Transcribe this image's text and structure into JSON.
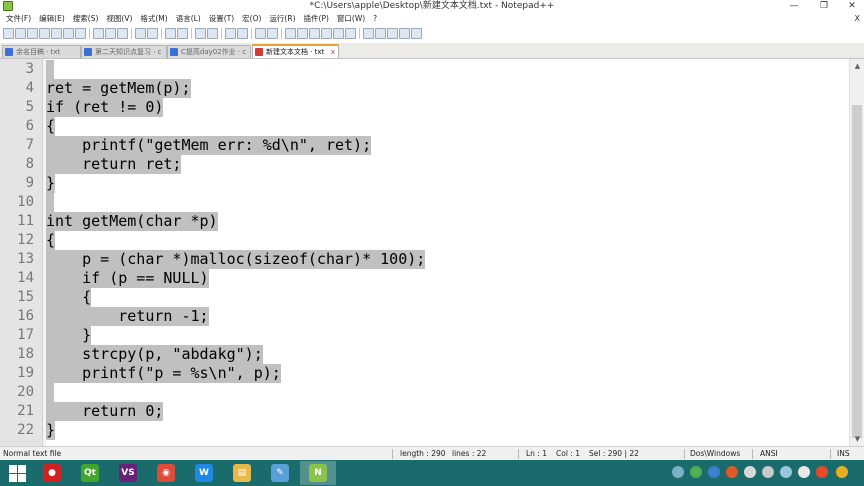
{
  "window": {
    "title": "*C:\\Users\\apple\\Desktop\\新建文本文档.txt - Notepad++",
    "minimize": "—",
    "maximize": "❐",
    "close": "✕"
  },
  "menu": [
    "文件(F)",
    "编辑(E)",
    "搜索(S)",
    "视图(V)",
    "格式(M)",
    "语言(L)",
    "设置(T)",
    "宏(O)",
    "运行(R)",
    "插件(P)",
    "窗口(W)",
    "?"
  ],
  "menu_close": "X",
  "tabs": [
    {
      "label": "余名目稿 · txt",
      "active": false
    },
    {
      "label": "第二天知识点复习 · c",
      "active": false
    },
    {
      "label": "C提高day02作业 · c",
      "active": false
    },
    {
      "label": "新建文本文档 · txt",
      "active": true
    }
  ],
  "tab_close": "x",
  "code_lines": [
    {
      "n": "3",
      "text": ""
    },
    {
      "n": "4",
      "text": "ret = getMem(p);"
    },
    {
      "n": "5",
      "text": "if (ret != 0)"
    },
    {
      "n": "6",
      "text": "{"
    },
    {
      "n": "7",
      "text": "    printf(\"getMem err: %d\\n\", ret);"
    },
    {
      "n": "8",
      "text": "    return ret;"
    },
    {
      "n": "9",
      "text": "}"
    },
    {
      "n": "10",
      "text": ""
    },
    {
      "n": "11",
      "text": "int getMem(char *p)"
    },
    {
      "n": "12",
      "text": "{"
    },
    {
      "n": "13",
      "text": "    p = (char *)malloc(sizeof(char)* 100);"
    },
    {
      "n": "14",
      "text": "    if (p == NULL)"
    },
    {
      "n": "15",
      "text": "    {"
    },
    {
      "n": "16",
      "text": "        return -1;"
    },
    {
      "n": "17",
      "text": "    }"
    },
    {
      "n": "18",
      "text": "    strcpy(p, \"abdakg\");"
    },
    {
      "n": "19",
      "text": "    printf(\"p = %s\\n\", p);"
    },
    {
      "n": "20",
      "text": ""
    },
    {
      "n": "21",
      "text": "    return 0;"
    },
    {
      "n": "22",
      "text": "}"
    }
  ],
  "scroll": {
    "up": "▲",
    "down": "▼"
  },
  "status": {
    "file_type": "Normal text file",
    "length": "length : 290",
    "lines": "lines : 22",
    "ln": "Ln : 1",
    "col": "Col : 1",
    "sel": "Sel : 290 | 22",
    "eol": "Dos\\Windows",
    "encoding": "ANSI",
    "mode": "INS"
  },
  "taskbar": {
    "apps": [
      {
        "icon": "red-record-icon",
        "color": "#d32020",
        "glyph": "●"
      },
      {
        "icon": "qt-creator-icon",
        "color": "#41a62a",
        "glyph": "Qt"
      },
      {
        "icon": "visual-studio-icon",
        "color": "#68217a",
        "glyph": "VS"
      },
      {
        "icon": "chrome-icon",
        "color": "#dd4b39",
        "glyph": "◉"
      },
      {
        "icon": "wps-writer-icon",
        "color": "#1e88e5",
        "glyph": "W"
      },
      {
        "icon": "file-explorer-icon",
        "color": "#e8b84a",
        "glyph": "▤"
      },
      {
        "icon": "paint-icon",
        "color": "#5aa0d8",
        "glyph": "✎"
      },
      {
        "icon": "notepad-plus-plus-icon",
        "color": "#8bc34a",
        "glyph": "N"
      }
    ],
    "active_app": "notepad-plus-plus-icon"
  },
  "colors": {
    "selection": "#c0c0c0",
    "gutter": "#e4e4e4",
    "taskbar": "#1a6b6b",
    "active_tab_accent": "#f0a030"
  }
}
